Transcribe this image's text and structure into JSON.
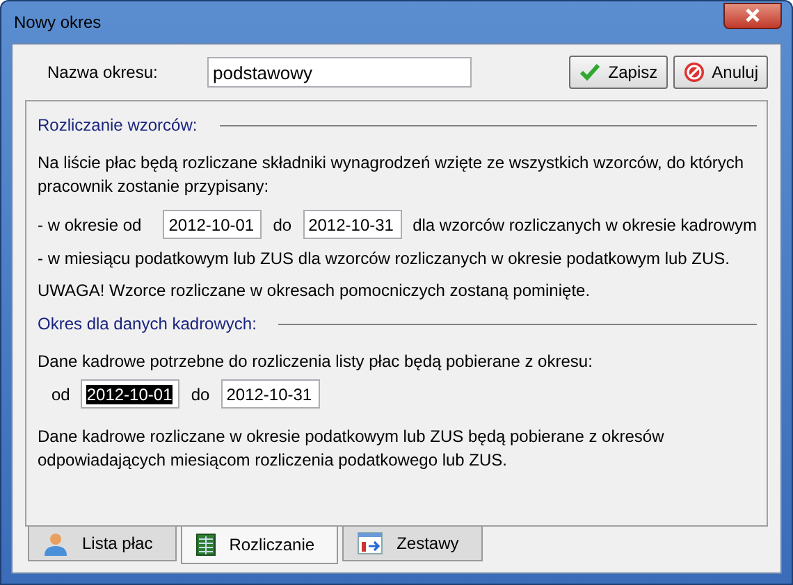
{
  "window": {
    "title": "Nowy okres"
  },
  "name_field": {
    "label": "Nazwa okresu:",
    "value": "podstawowy"
  },
  "buttons": [
    {
      "kind": "save",
      "label": "Zapisz"
    },
    {
      "kind": "cancel",
      "label": "Anuluj"
    }
  ],
  "settlement": {
    "title": "Rozliczanie wzorców:",
    "intro": "Na liście płac będą rozliczane składniki wynagrodzeń wzięte ze wszystkich wzorców, do których pracownik zostanie przypisany:",
    "range": {
      "prefix": "- w okresie od",
      "from": {
        "value": "2012-10-01",
        "highlighted": false
      },
      "to_label": "do",
      "to": {
        "value": "2012-10-31",
        "highlighted": false
      },
      "suffix": "dla wzorców rozliczanych w okresie kadrowym"
    },
    "notes": [
      "- w miesiącu podatkowym lub ZUS dla wzorców rozliczanych w okresie podatkowym lub ZUS.",
      "UWAGA! Wzorce rozliczane w okresach pomocniczych zostaną pominięte."
    ]
  },
  "hr_period": {
    "title": "Okres dla danych kadrowych:",
    "intro": "Dane kadrowe potrzebne do rozliczenia listy płac będą pobierane z okresu:",
    "range": {
      "from_label": "od",
      "from": {
        "value": "2012-10-01",
        "highlighted": true
      },
      "to_label": "do",
      "to": {
        "value": "2012-10-31",
        "highlighted": false
      }
    },
    "note": "Dane kadrowe rozliczane w okresie podatkowym lub ZUS będą pobierane z okresów odpowiadających miesiącom rozliczenia podatkowego lub ZUS."
  },
  "tabs": [
    {
      "label": "Lista płac",
      "kind": "person",
      "selected": false
    },
    {
      "label": "Rozliczanie",
      "kind": "sheet",
      "selected": true
    },
    {
      "label": "Zestawy",
      "kind": "window",
      "selected": false
    }
  ]
}
